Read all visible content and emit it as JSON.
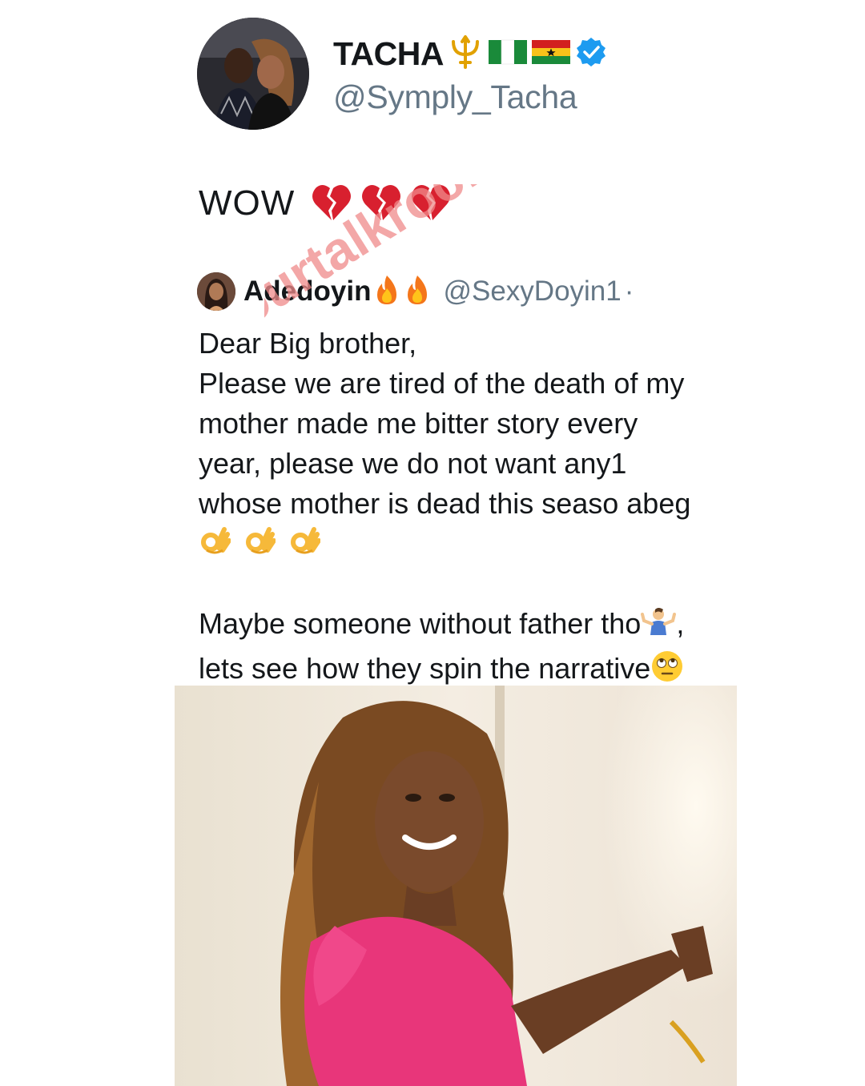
{
  "tweet": {
    "author": {
      "display_name": "TACHA",
      "name_emoji": [
        "trident-icon",
        "nigeria-flag-icon",
        "ghana-flag-icon"
      ],
      "verified": true,
      "handle": "@Symply_Tacha"
    },
    "comment_text": "WOW",
    "comment_emoji": [
      "broken-heart-icon",
      "broken-heart-icon",
      "broken-heart-icon"
    ]
  },
  "quoted_tweet": {
    "author": {
      "display_name": "Adedoyin",
      "name_emoji": [
        "fire-icon",
        "fire-icon"
      ],
      "handle": "@SexyDoyin1",
      "separator": "·"
    },
    "body_lines": [
      "Dear Big brother,",
      "Please we are tired of the death of my",
      "mother made me bitter story every",
      "year, please we do not want any1",
      "whose mother is dead this seaso abeg"
    ],
    "ok_emoji": [
      "ok-hand-icon",
      "ok-hand-icon",
      "ok-hand-icon"
    ],
    "body_lines_2": [
      "Maybe someone without father tho",
      "lets see how they spin the narrative"
    ],
    "line2_suffix": ","
  },
  "watermark": {
    "text": "ourtalkroom"
  },
  "colors": {
    "text": "#14171a",
    "muted": "#657786",
    "verified": "#1d9bf0",
    "watermark": "#f08a8a"
  }
}
